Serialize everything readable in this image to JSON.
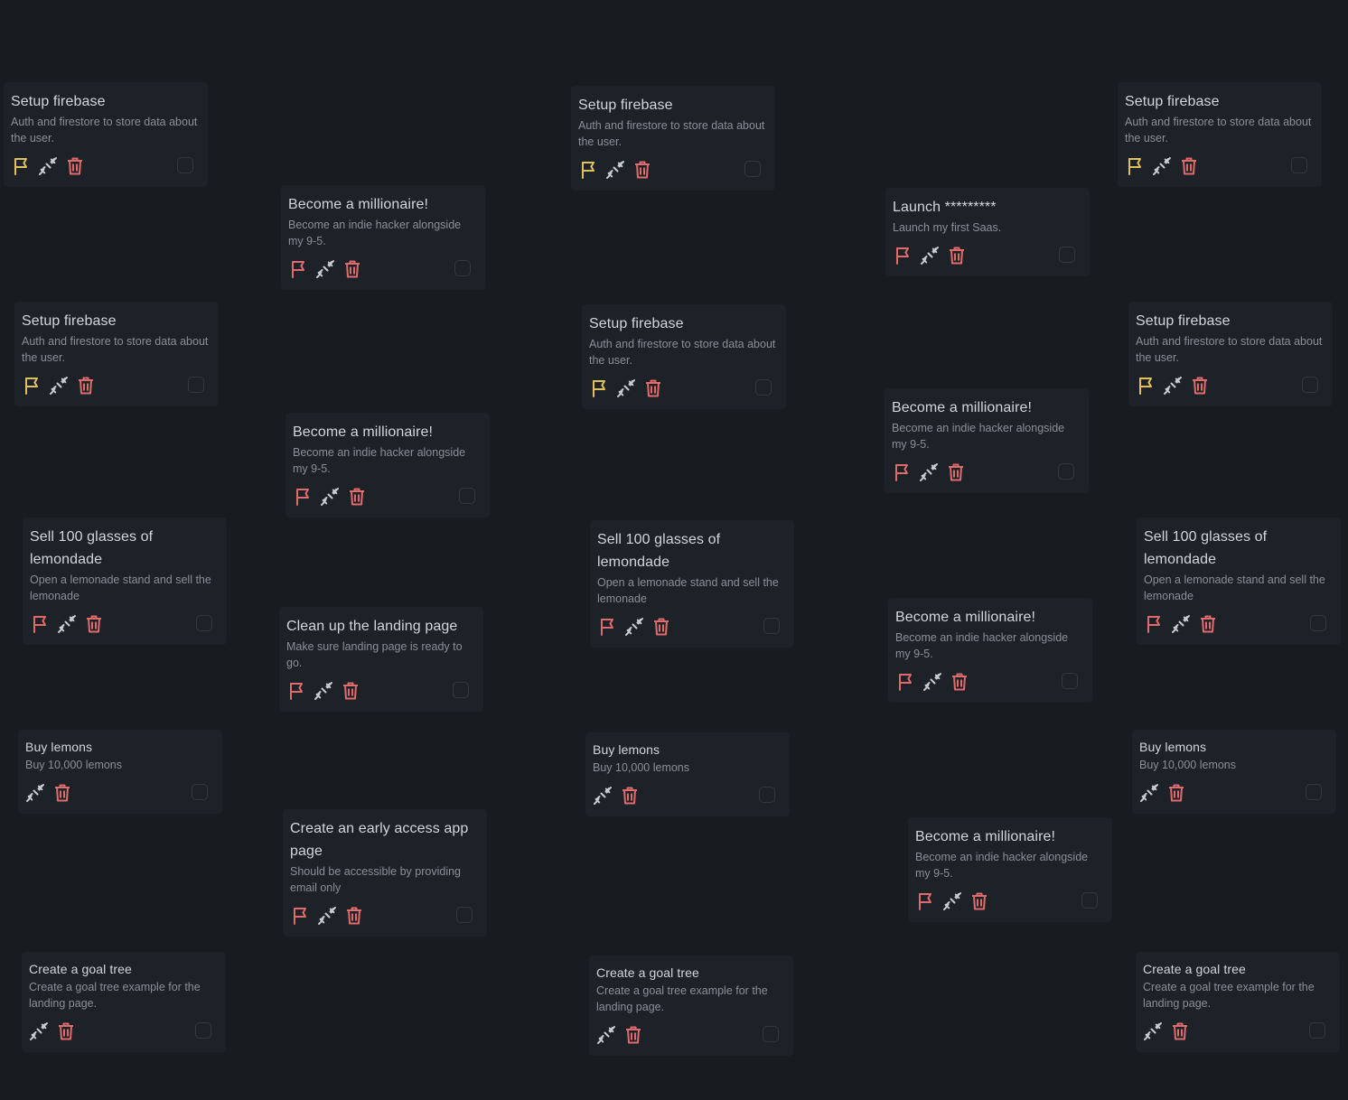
{
  "colors": {
    "background": "#181b20",
    "card": "#1d2128",
    "title": "#d3d6dc",
    "description": "#8a8f98",
    "flag_yellow": "#e2c15a",
    "flag_red": "#e06b6b",
    "trash_red": "#e06b6b",
    "link_icon": "#c8ccd2",
    "checkbox_border": "#33383f"
  },
  "icons": {
    "flag": "flag-icon",
    "link": "link-icon",
    "trash": "trash-icon"
  },
  "cards": [
    {
      "title": "Setup firebase",
      "desc": "Auth and firestore to store data about the user.",
      "flag": "yellow",
      "checked": false
    },
    {
      "title": "Become a millionaire!",
      "desc": "Become an indie hacker alongside my 9-5.",
      "flag": "red",
      "checked": false
    },
    {
      "title": "Setup firebase",
      "desc": "Auth and firestore to store data about the user.",
      "flag": "yellow",
      "checked": false
    },
    {
      "title": "Launch *********",
      "desc": "Launch my first Saas.",
      "flag": "red",
      "checked": false
    },
    {
      "title": "Setup firebase",
      "desc": "Auth and firestore to store data about the user.",
      "flag": "yellow",
      "checked": false
    },
    {
      "title": "Setup firebase",
      "desc": "Auth and firestore to store data about the user.",
      "flag": "yellow",
      "checked": false
    },
    {
      "title": "Become a millionaire!",
      "desc": "Become an indie hacker alongside my 9-5.",
      "flag": "red",
      "checked": false
    },
    {
      "title": "Setup firebase",
      "desc": "Auth and firestore to store data about the user.",
      "flag": "yellow",
      "checked": false
    },
    {
      "title": "Become a millionaire!",
      "desc": "Become an indie hacker alongside my 9-5.",
      "flag": "red",
      "checked": false
    },
    {
      "title": "Setup firebase",
      "desc": "Auth and firestore to store data about the user.",
      "flag": "yellow",
      "checked": false
    },
    {
      "title": "Sell 100 glasses of lemondade",
      "desc": "Open a lemonade stand and sell the lemonade",
      "flag": "red",
      "checked": false
    },
    {
      "title": "Clean up the landing page",
      "desc": "Make sure landing page is ready to go.",
      "flag": "red",
      "checked": false
    },
    {
      "title": "Sell 100 glasses of lemondade",
      "desc": "Open a lemonade stand and sell the lemonade",
      "flag": "red",
      "checked": false
    },
    {
      "title": "Become a millionaire!",
      "desc": "Become an indie hacker alongside my 9-5.",
      "flag": "red",
      "checked": false
    },
    {
      "title": "Sell 100 glasses of lemondade",
      "desc": "Open a lemonade stand and sell the lemonade",
      "flag": "red",
      "checked": false
    },
    {
      "title": "Buy lemons",
      "desc": "Buy 10,000 lemons",
      "flag": null,
      "checked": false
    },
    {
      "title": "Create an early access app page",
      "desc": "Should be accessible by providing email only",
      "flag": "red",
      "checked": false
    },
    {
      "title": "Buy lemons",
      "desc": "Buy 10,000 lemons",
      "flag": null,
      "checked": false
    },
    {
      "title": "Become a millionaire!",
      "desc": "Become an indie hacker alongside my 9-5.",
      "flag": "red",
      "checked": false
    },
    {
      "title": "Buy lemons",
      "desc": "Buy 10,000 lemons",
      "flag": null,
      "checked": false
    },
    {
      "title": "Create a goal tree",
      "desc": "Create a goal tree example for the landing page.",
      "flag": null,
      "checked": false
    },
    {
      "title": "Create a goal tree",
      "desc": "Create a goal tree example for the landing page.",
      "flag": null,
      "checked": false
    },
    {
      "title": "Create a goal tree",
      "desc": "Create a goal tree example for the landing page.",
      "flag": null,
      "checked": false
    }
  ]
}
